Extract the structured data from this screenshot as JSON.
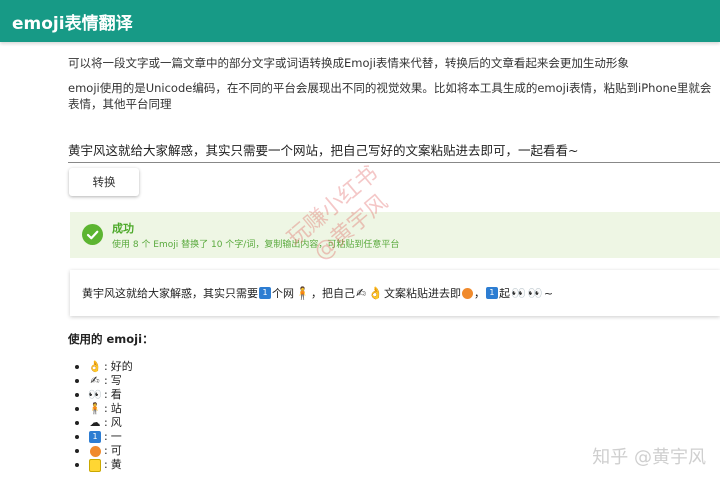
{
  "header": {
    "title": "emoji表情翻译"
  },
  "intro": {
    "line1": "可以将一段文字或一篇文章中的部分文字或词语转换成Emoji表情来代替，转换后的文章看起来会更加生动形象",
    "line2": "emoji使用的是Unicode编码，在不同的平台会展现出不同的视觉效果。比如将本工具生成的emoji表情，粘贴到iPhone里就会表情，其他平台同理"
  },
  "input": {
    "value": "黄宇风这就给大家解惑，其实只需要一个网站，把自己写好的文案粘贴进去即可，一起看看~"
  },
  "convert_label": "转换",
  "success": {
    "title": "成功",
    "message": "使用 8 个 Emoji 替换了 10 个字/词，复制输出内容，可粘贴到任意平台"
  },
  "result": {
    "seg1": "黄宇风这就给大家解惑，其实只需要",
    "seg2": "个网",
    "seg3": "，把自己",
    "seg4": "文案粘贴进去即",
    "seg5": "，",
    "seg6": "起",
    "seg7": "~",
    "sq_num": "1"
  },
  "used_heading": "使用的 emoji：",
  "emoji_list": [
    {
      "icon": "ok-hand-icon",
      "glyph": "👌",
      "word": "好的"
    },
    {
      "icon": "writing-hand-icon",
      "glyph": "✍",
      "word": "写"
    },
    {
      "icon": "eyes-icon",
      "glyph": "👀",
      "word": "看"
    },
    {
      "icon": "person-standing-icon",
      "glyph": "🧍",
      "word": "站"
    },
    {
      "icon": "wind-cloud-icon",
      "glyph": "☁",
      "word": "风"
    },
    {
      "icon": "keycap-one-icon",
      "glyph": "1",
      "word": "一"
    },
    {
      "icon": "ok-button-icon",
      "glyph": "",
      "word": "可"
    },
    {
      "icon": "yellow-square-icon",
      "glyph": "",
      "word": "黄"
    }
  ],
  "watermark": {
    "line1": "玩赚小红书",
    "line2": "@黄宇风"
  },
  "footer_watermark": "知乎 @黄宇风",
  "colors": {
    "header": "#179a86",
    "success_bg": "#eef6e4",
    "success_green": "#5cb531"
  }
}
